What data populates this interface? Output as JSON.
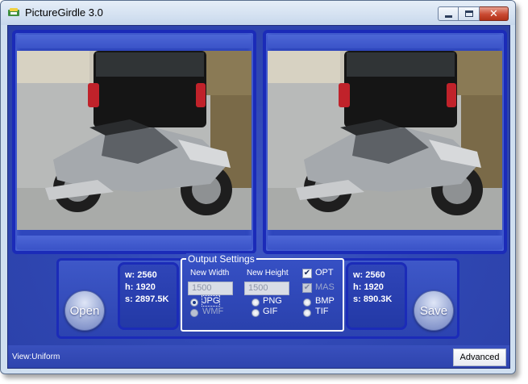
{
  "window": {
    "title": "PictureGirdle 3.0"
  },
  "title_controls": {
    "minimize_icon": "minimize-icon",
    "maximize_icon": "maximize-icon",
    "close_glyph": "✕"
  },
  "source": {
    "width": "w: 2560",
    "height": "h: 1920",
    "size": "s: 2897.5K"
  },
  "output": {
    "width": "w: 2560",
    "height": "h: 1920",
    "size": "s: 890.3K"
  },
  "buttons": {
    "open": "Open",
    "save": "Save",
    "advanced": "Advanced"
  },
  "settings": {
    "legend": "Output Settings",
    "new_width_label": "New Width",
    "new_height_label": "New Height",
    "new_width_value": "1500",
    "new_height_value": "1500",
    "opt": "OPT",
    "mas": "MAS",
    "formats": {
      "jpg": "JPG",
      "wmf": "WMF",
      "png": "PNG",
      "gif": "GIF",
      "bmp": "BMP",
      "tif": "TIF"
    },
    "selected_format": "JPG",
    "opt_checked": true,
    "mas_checked": true
  },
  "status": {
    "view": "View:Uniform"
  },
  "colors": {
    "panel_blue": "#2f47bd",
    "frame_blue": "#1b2bb8",
    "close_red": "#c94a32"
  }
}
